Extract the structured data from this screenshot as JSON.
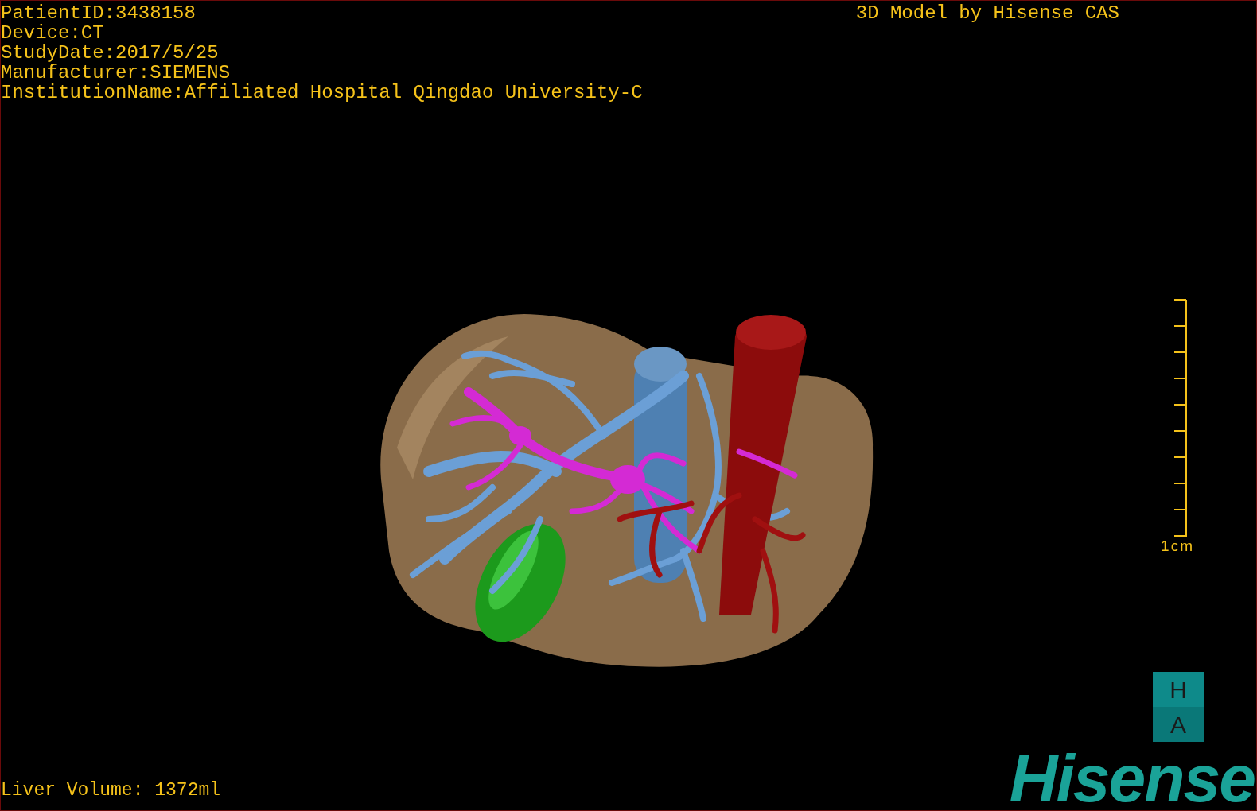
{
  "patient_info": [
    "PatientID:3438158",
    "Device:CT",
    "StudyDate:2017/5/25",
    "Manufacturer:SIEMENS",
    "InstitutionName:Affiliated Hospital Qingdao University-C"
  ],
  "title": "3D Model by Hisense CAS",
  "scale_bar": {
    "label": "1cm"
  },
  "liver_volume": "Liver Volume: 1372ml",
  "orientation_marker": {
    "top": "H",
    "bottom": "A"
  },
  "logo": "Hisense"
}
